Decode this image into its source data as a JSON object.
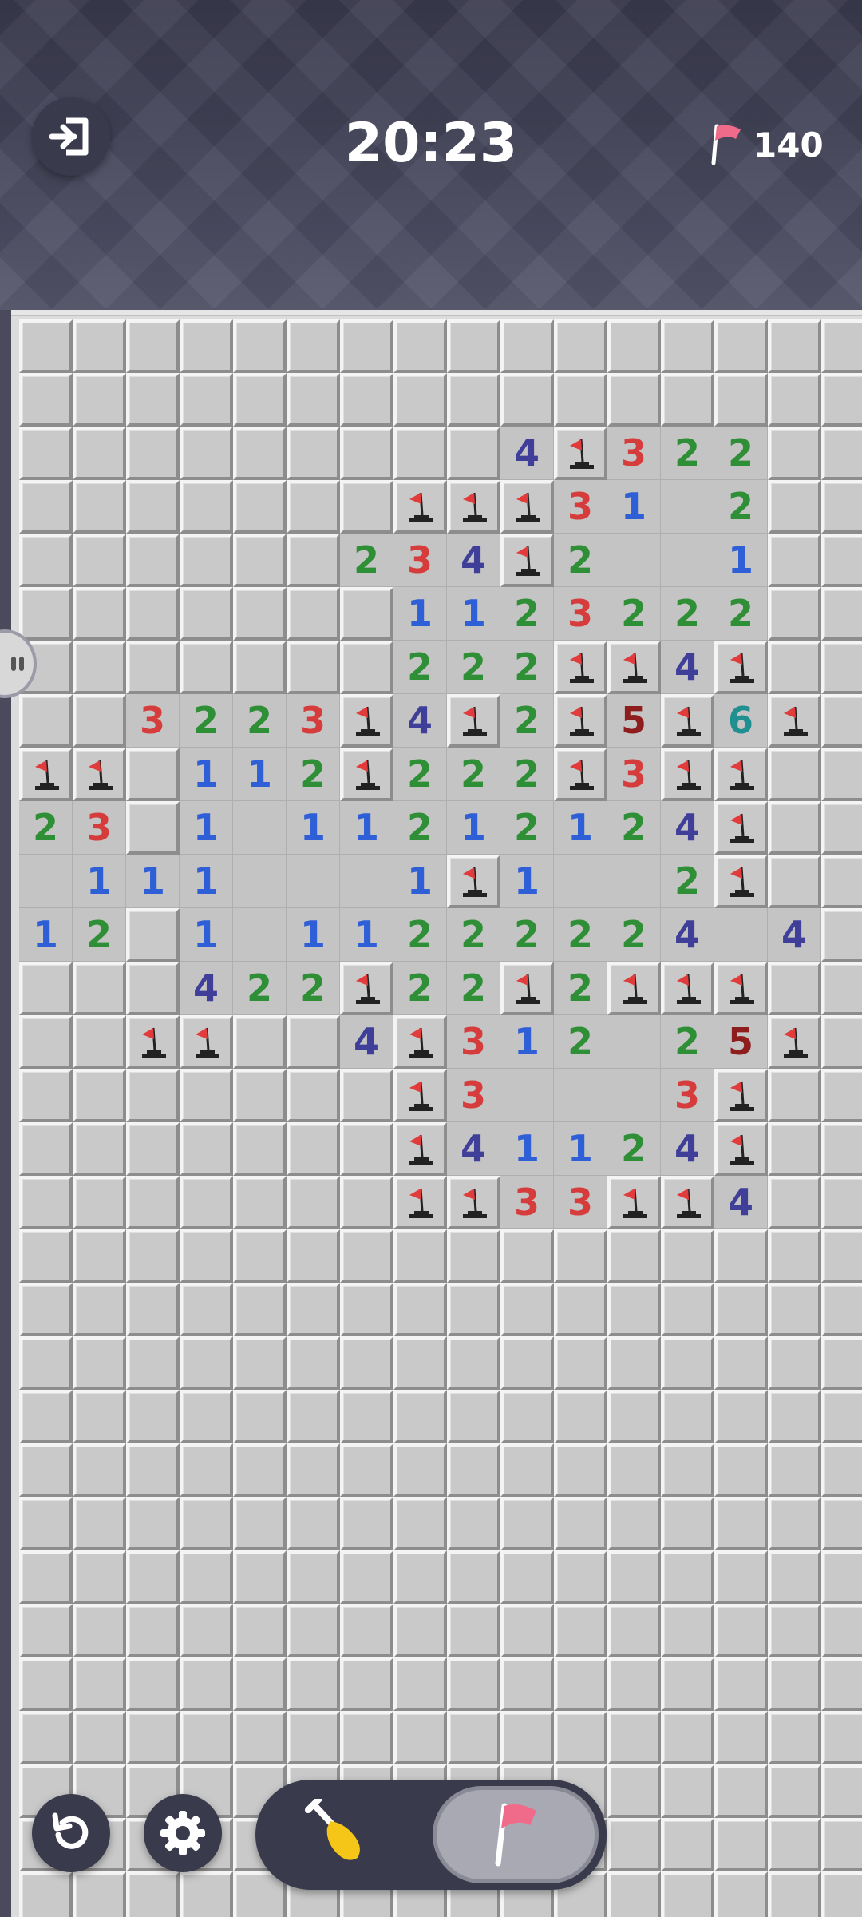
{
  "header": {
    "timer": "20:23",
    "flag_count": "140"
  },
  "icons": {
    "exit": "exit-icon",
    "flag_counter": "flag-icon",
    "undo": "undo-icon",
    "settings": "gear-icon",
    "dig": "shovel-icon",
    "flag_mode": "flag-icon"
  },
  "colors": {
    "n1": "#2f5fd6",
    "n2": "#2f8f36",
    "n3": "#d63c3c",
    "n4": "#3f3f9a",
    "n5": "#8e1d1d",
    "n6": "#1f8f8f",
    "flag_red": "#e23b3b",
    "pink_flag": "#f06b8a"
  },
  "board": {
    "cols": 16,
    "rows": 30,
    "legend": "# = closed, . = opened blank, F = flag, digits = adjacent mine counts",
    "grid": [
      "################",
      "################",
      "#########4F322##",
      "#######FFF31.2##",
      "######234F2..1##",
      "#######1123222##",
      "#######222FF4F##",
      "##3223F4F2F5F6F#",
      "FF#112F222F3FF##",
      "23#1.11212124F##",
      ".111...1F1..2F##",
      "12#1.11222224 4#",
      "###422F22F2FFF##",
      "##FF##4F312 25F##",
      "#######F3...3F##",
      "#######F41124F##",
      "#######FF33FF4##",
      "################",
      "################",
      "################",
      "################",
      "################",
      "################",
      "################",
      "################",
      "################",
      "################",
      "################",
      "################",
      "################"
    ]
  }
}
